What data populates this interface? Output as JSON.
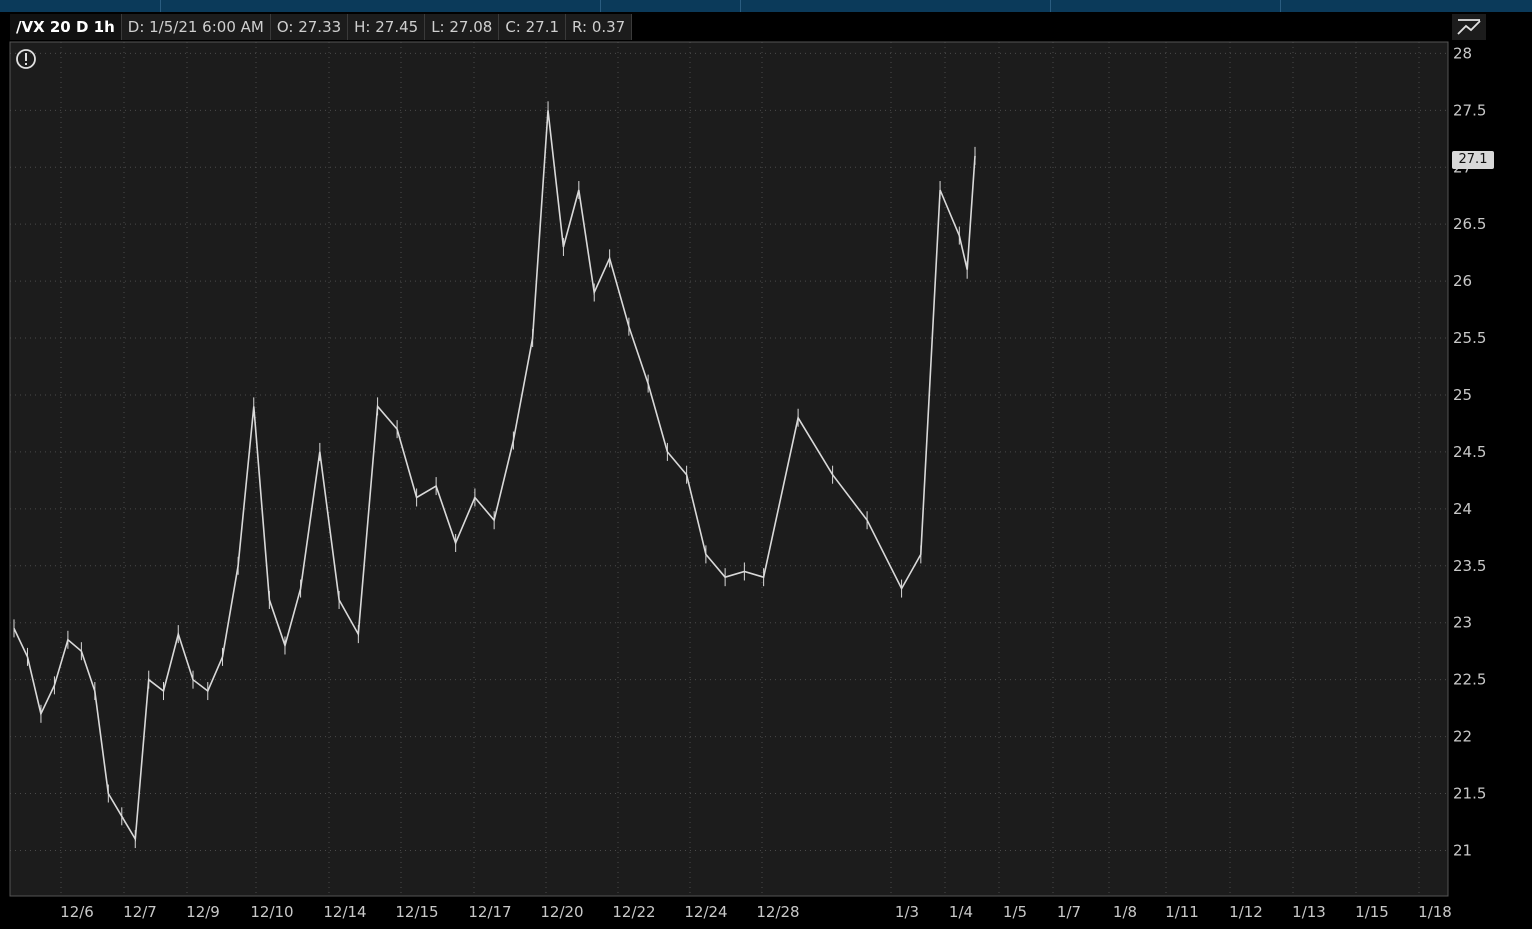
{
  "header": {
    "symbol": "/VX 20 D 1h",
    "date": "D: 1/5/21 6:00 AM",
    "open": "O: 27.33",
    "high": "H: 27.45",
    "low": "L: 27.08",
    "close": "C: 27.1",
    "range": "R: 0.37"
  },
  "price_tag": "27.1",
  "colors": {
    "background": "#1c1c1c",
    "price_line": "#d9d9d9",
    "grid": "#4a4a4a",
    "axis_text": "#c8c8c8",
    "top_strip": "#0b3a5a"
  },
  "icons": [
    "alert-icon",
    "chart-settings-icon"
  ],
  "chart_data": {
    "type": "line",
    "title": "",
    "xlabel": "",
    "ylabel": "",
    "ylim": [
      20.6,
      28.1
    ],
    "y_ticks": [
      21,
      21.5,
      22,
      22.5,
      23,
      23.5,
      24,
      24.5,
      25,
      25.5,
      26,
      26.5,
      27,
      27.5,
      28
    ],
    "x_tick_labels": [
      "12/6",
      "12/7",
      "12/9",
      "12/10",
      "12/14",
      "12/15",
      "12/17",
      "12/20",
      "12/22",
      "12/24",
      "12/28",
      "1/3",
      "1/4",
      "1/5",
      "1/7",
      "1/8",
      "1/11",
      "1/12",
      "1/13",
      "1/15",
      "1/18"
    ],
    "grid": true,
    "series": [
      {
        "x": [
          "12/6",
          "12/6",
          "12/6",
          "12/6",
          "12/6",
          "12/7",
          "12/7",
          "12/7",
          "12/7",
          "12/7",
          "12/9",
          "12/9",
          "12/9",
          "12/9",
          "12/9",
          "12/10",
          "12/10",
          "12/10",
          "12/10",
          "12/10",
          "12/14",
          "12/14",
          "12/14",
          "12/14",
          "12/15",
          "12/15",
          "12/15",
          "12/15",
          "12/17",
          "12/17",
          "12/17",
          "12/17",
          "12/20",
          "12/20",
          "12/20",
          "12/20",
          "12/20",
          "12/22",
          "12/22",
          "12/22",
          "12/22",
          "12/24",
          "12/24",
          "12/24",
          "12/24",
          "12/28",
          "12/28",
          "12/28",
          "12/28",
          "1/3",
          "1/3",
          "1/3",
          "1/4",
          "1/4",
          "1/4"
        ],
        "y": [
          22.95,
          22.7,
          22.2,
          22.45,
          22.85,
          22.75,
          22.4,
          21.5,
          21.3,
          21.1,
          22.5,
          22.4,
          22.9,
          22.5,
          22.4,
          22.7,
          23.5,
          24.9,
          23.2,
          22.8,
          23.3,
          24.5,
          23.2,
          22.9,
          24.9,
          24.7,
          24.1,
          24.2,
          23.7,
          24.1,
          23.9,
          24.6,
          25.5,
          27.5,
          26.3,
          26.8,
          25.9,
          26.2,
          25.6,
          25.1,
          24.5,
          24.3,
          23.6,
          23.4,
          23.45,
          23.4,
          24.8,
          24.3,
          23.9,
          23.3,
          23.6,
          26.8,
          26.4,
          26.1,
          27.1
        ]
      }
    ],
    "last_price": 27.1
  }
}
